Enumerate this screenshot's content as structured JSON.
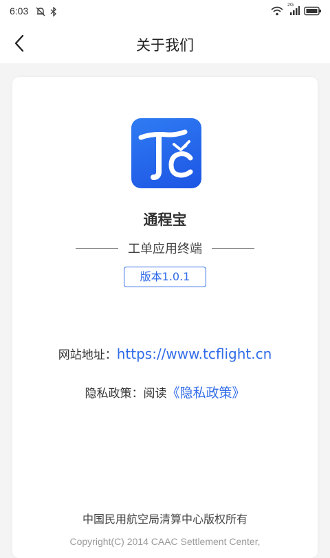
{
  "status_bar": {
    "time": "6:03",
    "network_label": "2G"
  },
  "header": {
    "title": "关于我们"
  },
  "app": {
    "name": "通程宝",
    "subtitle": "工单应用终端",
    "version": "版本1.0.1",
    "logo_text": "Tc"
  },
  "info": {
    "website_label": "网站地址：",
    "website_url": "https://www.tcflight.cn",
    "privacy_label": "隐私政策：阅读",
    "privacy_link": "《隐私政策》"
  },
  "footer": {
    "copyright_cn": "中国民用航空局清算中心版权所有",
    "copyright_en": "Copyright(C) 2014 CAAC Settlement Center,"
  },
  "colors": {
    "accent": "#2f6be8",
    "logo_gradient_start": "#2f7cf3",
    "logo_gradient_end": "#1d55e4",
    "background": "#f4f4f4",
    "card": "#ffffff"
  },
  "icons": [
    "alarm-off-icon",
    "bluetooth-icon",
    "wifi-icon",
    "signal-icon",
    "battery-icon",
    "back-arrow-icon"
  ]
}
